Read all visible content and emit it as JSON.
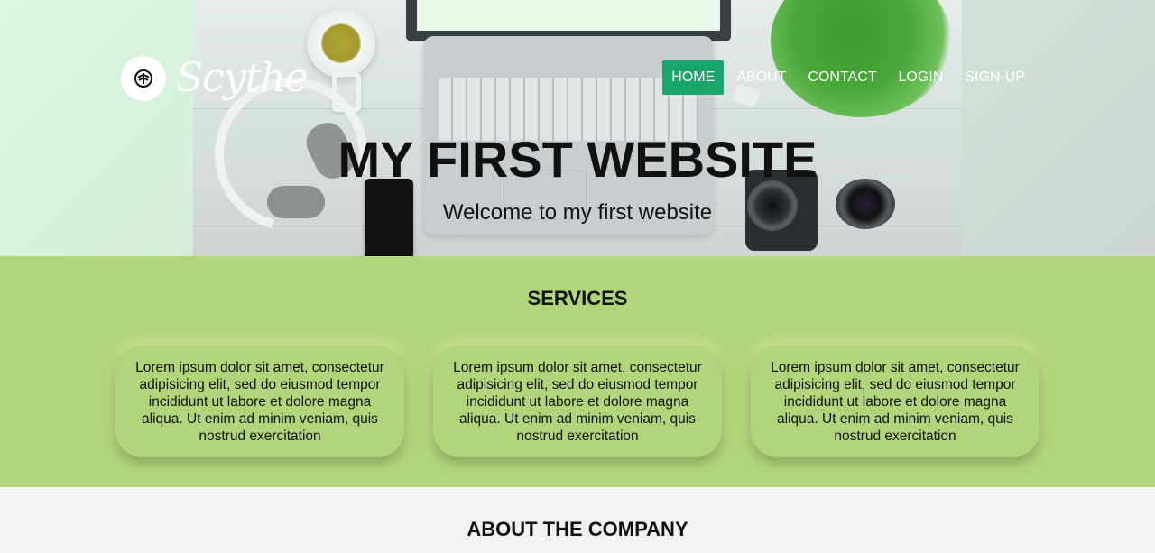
{
  "brand": {
    "name": "Scythe",
    "logo_icon": "palm-tree-icon"
  },
  "nav": {
    "items": [
      {
        "label": "HOME",
        "active": true
      },
      {
        "label": "ABOUT",
        "active": false
      },
      {
        "label": "CONTACT",
        "active": false
      },
      {
        "label": "LOGIN",
        "active": false
      },
      {
        "label": "SIGN-UP",
        "active": false
      }
    ]
  },
  "hero": {
    "title": "MY FIRST WEBSITE",
    "subtitle": "Welcome to my first website"
  },
  "services": {
    "title": "SERVICES",
    "cards": [
      {
        "text": "Lorem ipsum dolor sit amet, consectetur adipisicing elit, sed do eiusmod tempor incididunt ut labore et dolore magna aliqua. Ut enim ad minim veniam, quis nostrud exercitation"
      },
      {
        "text": "Lorem ipsum dolor sit amet, consectetur adipisicing elit, sed do eiusmod tempor incididunt ut labore et dolore magna aliqua. Ut enim ad minim veniam, quis nostrud exercitation"
      },
      {
        "text": "Lorem ipsum dolor sit amet, consectetur adipisicing elit, sed do eiusmod tempor incididunt ut labore et dolore magna aliqua. Ut enim ad minim veniam, quis nostrud exercitation"
      }
    ]
  },
  "about": {
    "title": "ABOUT THE COMPANY"
  },
  "colors": {
    "nav_active": "#1aa56b",
    "services_bg": "#b1d57a",
    "about_bg": "#f2f2f2",
    "text": "#111111"
  }
}
